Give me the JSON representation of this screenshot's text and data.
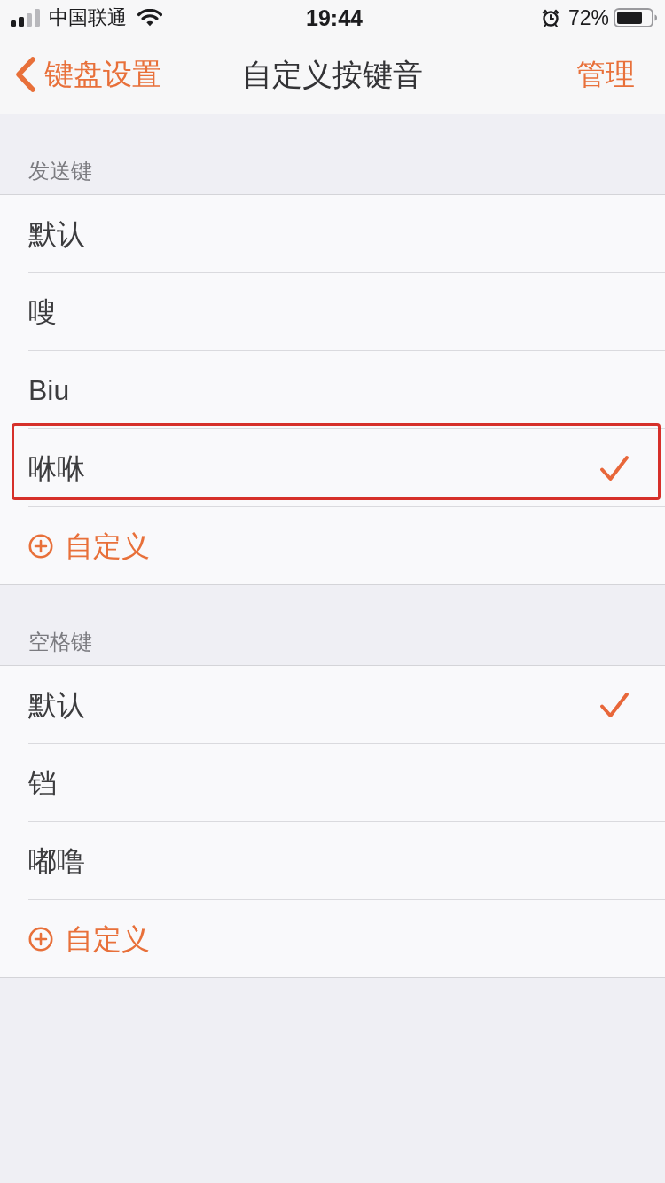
{
  "status_bar": {
    "carrier": "中国联通",
    "time": "19:44",
    "battery": "72%"
  },
  "nav_bar": {
    "back": "键盘设置",
    "title": "自定义按键音",
    "action": "管理"
  },
  "sections": [
    {
      "header": "发送键",
      "items": [
        {
          "label": "默认",
          "selected": false,
          "highlighted": false
        },
        {
          "label": "嗖",
          "selected": false,
          "highlighted": false
        },
        {
          "label": "Biu",
          "selected": false,
          "highlighted": false
        },
        {
          "label": "咻咻",
          "selected": true,
          "highlighted": true
        }
      ],
      "add_button": "自定义"
    },
    {
      "header": "空格键",
      "items": [
        {
          "label": "默认",
          "selected": true,
          "highlighted": false
        },
        {
          "label": "铛",
          "selected": false,
          "highlighted": false
        },
        {
          "label": "嘟噜",
          "selected": false,
          "highlighted": false
        }
      ],
      "add_button": "自定义"
    }
  ]
}
